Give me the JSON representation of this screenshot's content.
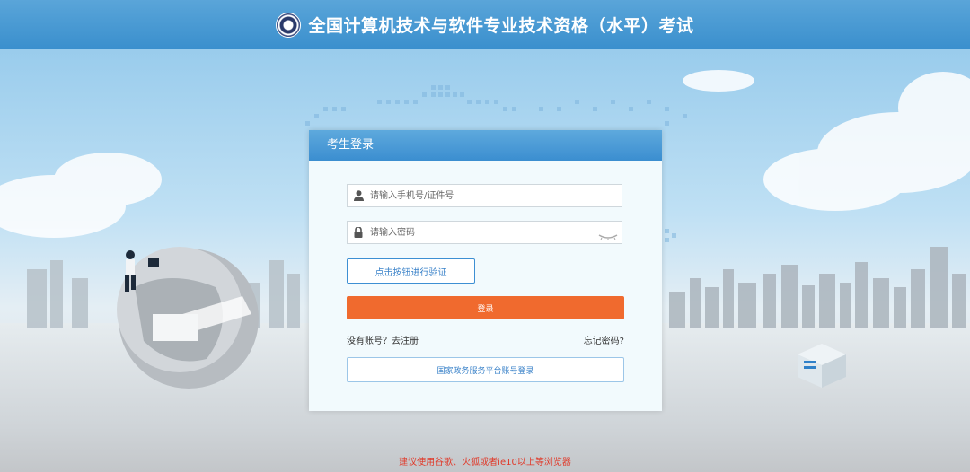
{
  "header": {
    "title": "全国计算机技术与软件专业技术资格（水平）考试",
    "logo_icon": "exam-logo-icon"
  },
  "login": {
    "title": "考生登录",
    "username_placeholder": "请输入手机号/证件号",
    "password_placeholder": "请输入密码",
    "verify_label": "点击按钮进行验证",
    "login_label": "登录",
    "register_text": "没有账号？去注册",
    "forgot_text": "忘记密码?",
    "gov_login_label": "国家政务服务平台账号登录"
  },
  "footer": {
    "browser_note": "建议使用谷歌、火狐或者ie10以上等浏览器"
  },
  "colors": {
    "header": "#3a8fcd",
    "login_button": "#f06a2e",
    "note": "#e03a2a"
  }
}
